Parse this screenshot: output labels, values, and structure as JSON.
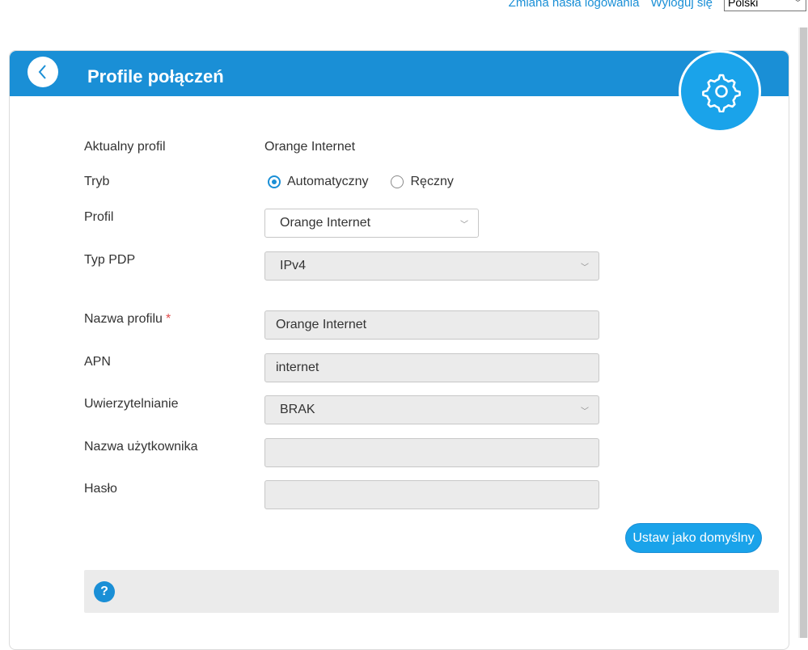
{
  "topbar": {
    "change_password": "Zmiana hasła logowania",
    "logout": "Wyloguj się",
    "language": "Polski"
  },
  "card": {
    "title": "Profile połączeń"
  },
  "form": {
    "current_profile_label": "Aktualny profil",
    "current_profile_value": "Orange Internet",
    "mode_label": "Tryb",
    "mode_options": [
      "Automatyczny",
      "Ręczny"
    ],
    "mode_selected": "Automatyczny",
    "profile_label": "Profil",
    "profile_value": "Orange Internet",
    "pdp_label": "Typ PDP",
    "pdp_value": "IPv4",
    "profile_name_label": "Nazwa profilu",
    "profile_name_required": "*",
    "profile_name_value": "Orange Internet",
    "apn_label": "APN",
    "apn_value": "internet",
    "auth_label": "Uwierzytelnianie",
    "auth_value": "BRAK",
    "username_label": "Nazwa użytkownika",
    "username_value": "",
    "password_label": "Hasło",
    "password_value": ""
  },
  "buttons": {
    "set_default": "Ustaw jako domyślny"
  },
  "help": {
    "icon_glyph": "?"
  },
  "colors": {
    "accent": "#1a8fd6",
    "accent_light": "#1aa3ea",
    "field_bg": "#ebebeb"
  },
  "icons": {
    "back": "chevron-left-icon",
    "settings": "gear-icon",
    "help": "question-icon"
  }
}
